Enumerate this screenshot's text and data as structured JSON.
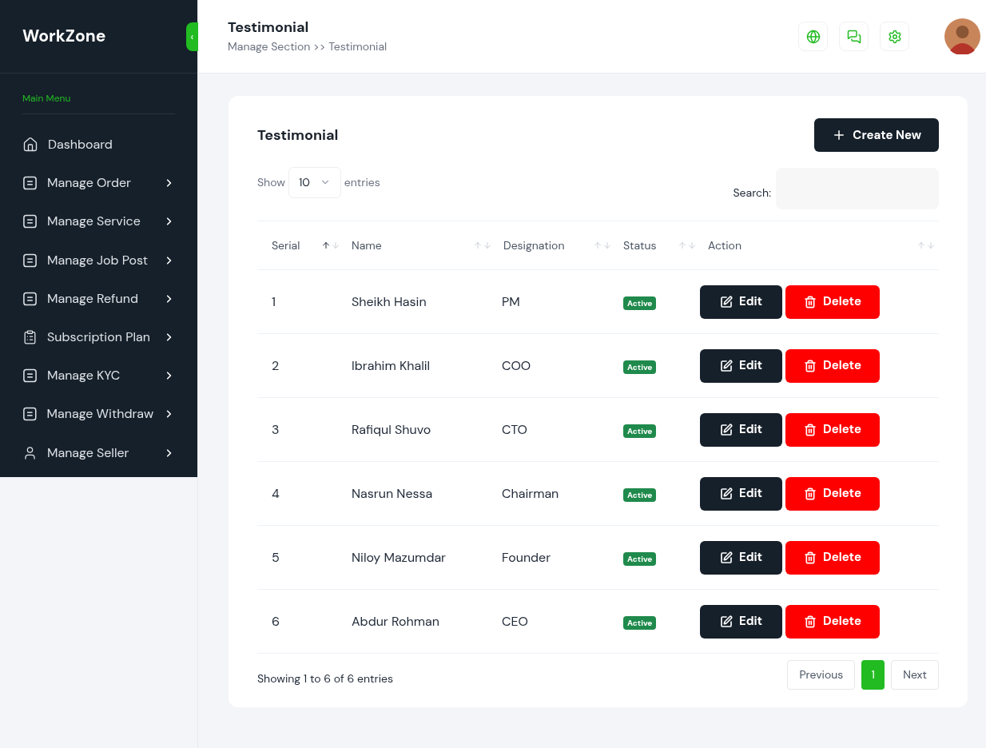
{
  "sidebar": {
    "logo": "WorkZone",
    "collapse_glyph": "‹",
    "section_label": "Main Menu",
    "items": [
      {
        "label": "Dashboard",
        "kind": "home",
        "submenu": false
      },
      {
        "label": "Manage Order",
        "kind": "list",
        "submenu": true
      },
      {
        "label": "Manage Service",
        "kind": "list",
        "submenu": true
      },
      {
        "label": "Manage Job Post",
        "kind": "list",
        "submenu": true
      },
      {
        "label": "Manage Refund",
        "kind": "list",
        "submenu": true
      },
      {
        "label": "Subscription Plan",
        "kind": "clipboard",
        "submenu": true
      },
      {
        "label": "Manage KYC",
        "kind": "list",
        "submenu": true
      },
      {
        "label": "Manage Withdraw",
        "kind": "list",
        "submenu": true
      },
      {
        "label": "Manage Seller",
        "kind": "user",
        "submenu": true
      }
    ]
  },
  "header": {
    "title": "Testimonial",
    "breadcrumb": "Manage Section >> Testimonial"
  },
  "card": {
    "title": "Testimonial",
    "create_button": "Create New",
    "show_label": "Show",
    "page_size": "10",
    "entries_label": "entries",
    "search_label": "Search:",
    "columns": [
      {
        "label": "Serial",
        "sorted": true
      },
      {
        "label": "Name",
        "sorted": false
      },
      {
        "label": "Designation",
        "sorted": false
      },
      {
        "label": "Status",
        "sorted": false
      },
      {
        "label": "Action",
        "sorted": false
      }
    ],
    "rows": [
      {
        "serial": "1",
        "name": "Sheikh Hasin",
        "designation": "PM",
        "status": "Active",
        "edit": "Edit",
        "delete": "Delete"
      },
      {
        "serial": "2",
        "name": "Ibrahim Khalil",
        "designation": "COO",
        "status": "Active",
        "edit": "Edit",
        "delete": "Delete"
      },
      {
        "serial": "3",
        "name": "Rafiqul Shuvo",
        "designation": "CTO",
        "status": "Active",
        "edit": "Edit",
        "delete": "Delete"
      },
      {
        "serial": "4",
        "name": "Nasrun Nessa",
        "designation": "Chairman",
        "status": "Active",
        "edit": "Edit",
        "delete": "Delete"
      },
      {
        "serial": "5",
        "name": "Niloy Mazumdar",
        "designation": "Founder",
        "status": "Active",
        "edit": "Edit",
        "delete": "Delete"
      },
      {
        "serial": "6",
        "name": "Abdur Rohman",
        "designation": "CEO",
        "status": "Active",
        "edit": "Edit",
        "delete": "Delete"
      }
    ],
    "info": "Showing 1 to 6 of 6 entries",
    "pagination": [
      {
        "label": "Previous",
        "kind": "nav",
        "selected": false
      },
      {
        "label": "1",
        "kind": "page",
        "selected": true
      },
      {
        "label": "Next",
        "kind": "nav",
        "selected": false
      }
    ]
  }
}
